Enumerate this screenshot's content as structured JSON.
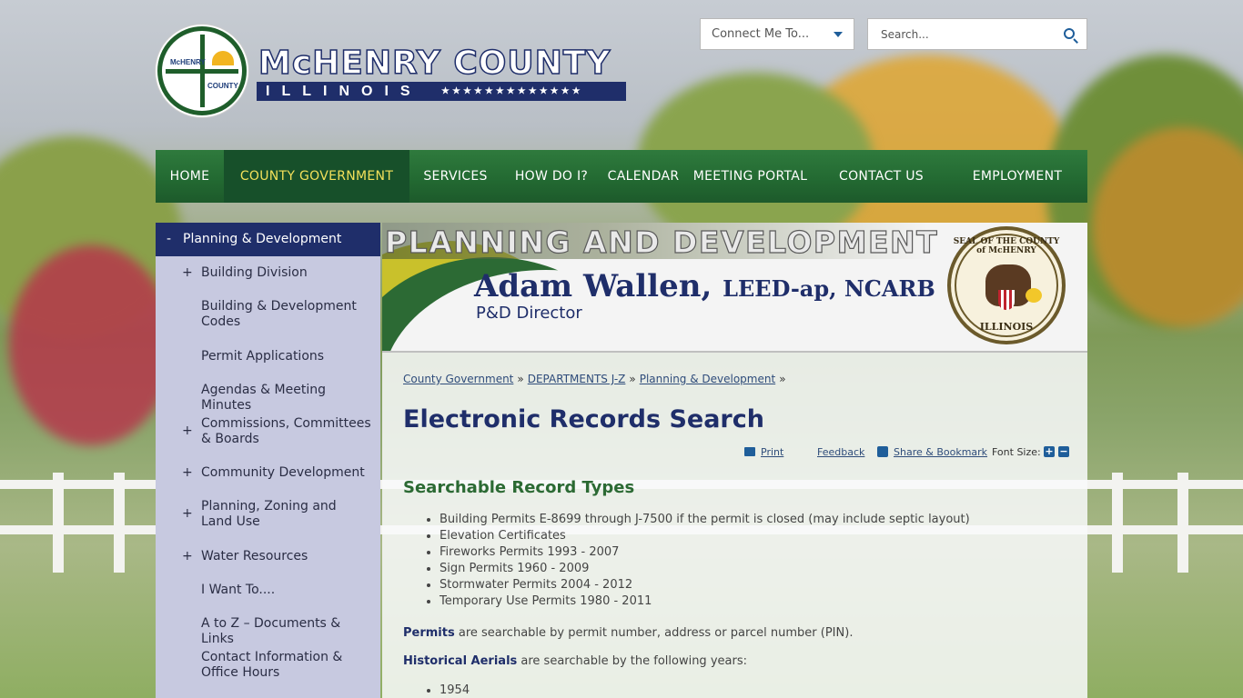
{
  "header": {
    "logo_seal_top": "McHENRY",
    "logo_seal_bottom": "COUNTY",
    "logo_title": "McHENRY COUNTY",
    "logo_subtitle": "ILLINOIS",
    "connect_label": "Connect Me To...",
    "search_placeholder": "Search..."
  },
  "nav": {
    "items": [
      {
        "label": "HOME",
        "active": false
      },
      {
        "label": "COUNTY GOVERNMENT",
        "active": true
      },
      {
        "label": "SERVICES",
        "active": false
      },
      {
        "label": "HOW DO I?",
        "active": false
      },
      {
        "label": "CALENDAR",
        "active": false
      },
      {
        "label": "MEETING PORTAL",
        "active": false
      },
      {
        "label": "CONTACT US",
        "active": false
      },
      {
        "label": "EMPLOYMENT",
        "active": false
      }
    ]
  },
  "sidebar": {
    "header": "Planning & Development",
    "items": [
      {
        "label": "Building Division",
        "expandable": true
      },
      {
        "label": "Building & Development Codes",
        "expandable": false
      },
      {
        "label": "Permit Applications",
        "expandable": false
      },
      {
        "label": "Agendas & Meeting Minutes",
        "expandable": false
      },
      {
        "label": "Commissions, Committees & Boards",
        "expandable": true
      },
      {
        "label": "Community Development",
        "expandable": true
      },
      {
        "label": "Planning, Zoning and Land Use",
        "expandable": true
      },
      {
        "label": "Water Resources",
        "expandable": true
      },
      {
        "label": "I Want To....",
        "expandable": false
      },
      {
        "label": "A to Z – Documents & Links",
        "expandable": false
      },
      {
        "label": "Contact Information & Office Hours",
        "expandable": false
      }
    ]
  },
  "banner": {
    "title": "PLANNING AND DEVELOPMENT",
    "name": "Adam Wallen,",
    "credentials": "LEED-ap, NCARB",
    "role": "P&D Director",
    "seal_top": "SEAL OF THE COUNTY of McHENRY",
    "seal_bottom": "ILLINOIS"
  },
  "breadcrumbs": [
    "County Government",
    "DEPARTMENTS J-Z",
    "Planning & Development"
  ],
  "page": {
    "title": "Electronic Records Search",
    "tools": {
      "print": "Print",
      "feedback": "Feedback",
      "share": "Share & Bookmark",
      "font_size": "Font Size:"
    },
    "section_title": "Searchable Record Types",
    "record_types": [
      "Building Permits E-8699 through J-7500 if the permit is closed (may include septic layout)",
      "Elevation Certificates",
      "Fireworks Permits 1993 - 2007",
      "Sign Permits 1960 - 2009",
      "Stormwater Permits 2004 - 2012",
      "Temporary Use Permits 1980 - 2011"
    ],
    "permits_bold": "Permits",
    "permits_text": " are searchable by permit number, address or parcel number (PIN).",
    "aerials_bold": "Historical Aerials",
    "aerials_text": " are searchable by the following years:",
    "aerial_years": [
      "1954"
    ]
  }
}
